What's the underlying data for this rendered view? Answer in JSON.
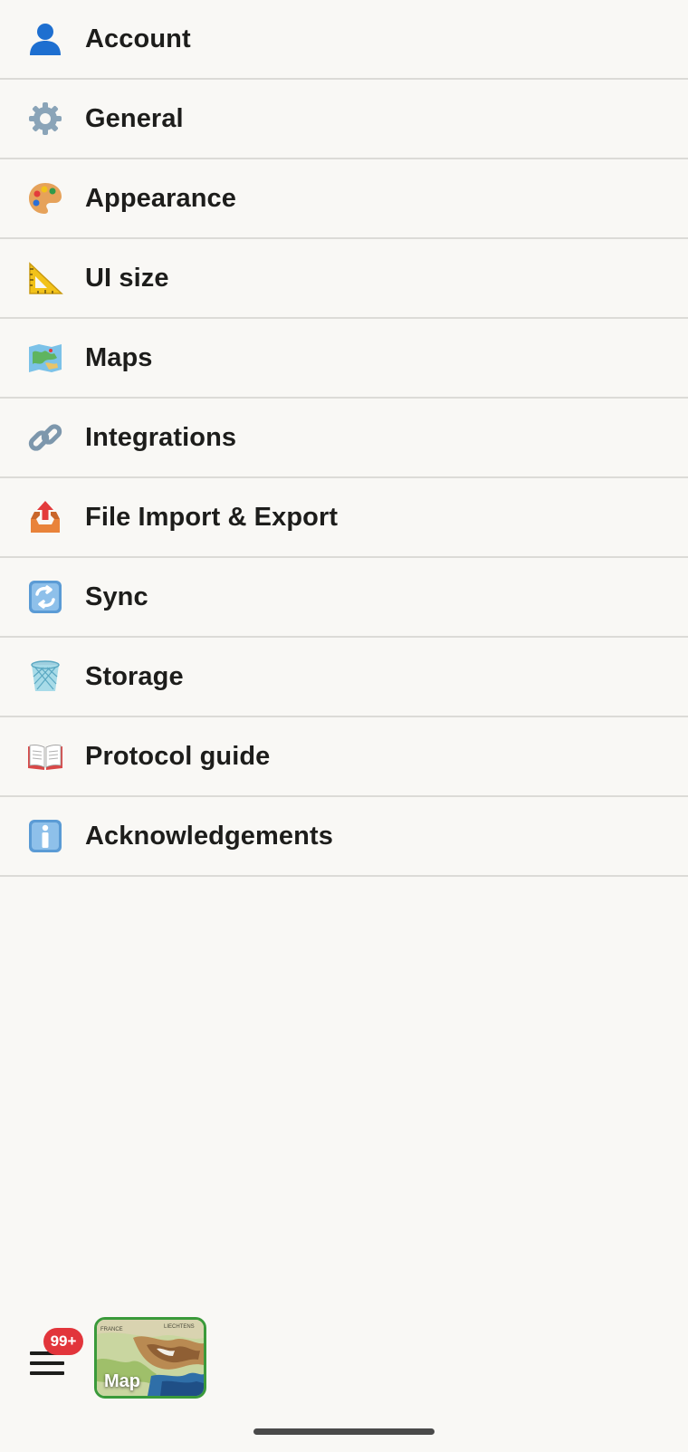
{
  "menu": {
    "items": [
      {
        "label": "Account",
        "icon": "person-icon"
      },
      {
        "label": "General",
        "icon": "gear-icon"
      },
      {
        "label": "Appearance",
        "icon": "palette-icon"
      },
      {
        "label": "UI size",
        "icon": "triangle-ruler-icon"
      },
      {
        "label": "Maps",
        "icon": "map-icon"
      },
      {
        "label": "Integrations",
        "icon": "link-icon"
      },
      {
        "label": "File Import & Export",
        "icon": "outbox-tray-icon"
      },
      {
        "label": "Sync",
        "icon": "sync-arrows-icon"
      },
      {
        "label": "Storage",
        "icon": "wastebasket-icon"
      },
      {
        "label": "Protocol guide",
        "icon": "open-book-icon"
      },
      {
        "label": "Acknowledgements",
        "icon": "info-icon"
      }
    ]
  },
  "bottom_bar": {
    "badge_text": "99+",
    "map_label": "Map",
    "map_tile_labels": [
      "FRANCE",
      "LIECHTENS"
    ]
  },
  "colors": {
    "background": "#f9f8f5",
    "divider": "#dcdbd7",
    "text": "#1d1d1b",
    "badge": "#e2353b",
    "map_border": "#3a9a3a"
  }
}
